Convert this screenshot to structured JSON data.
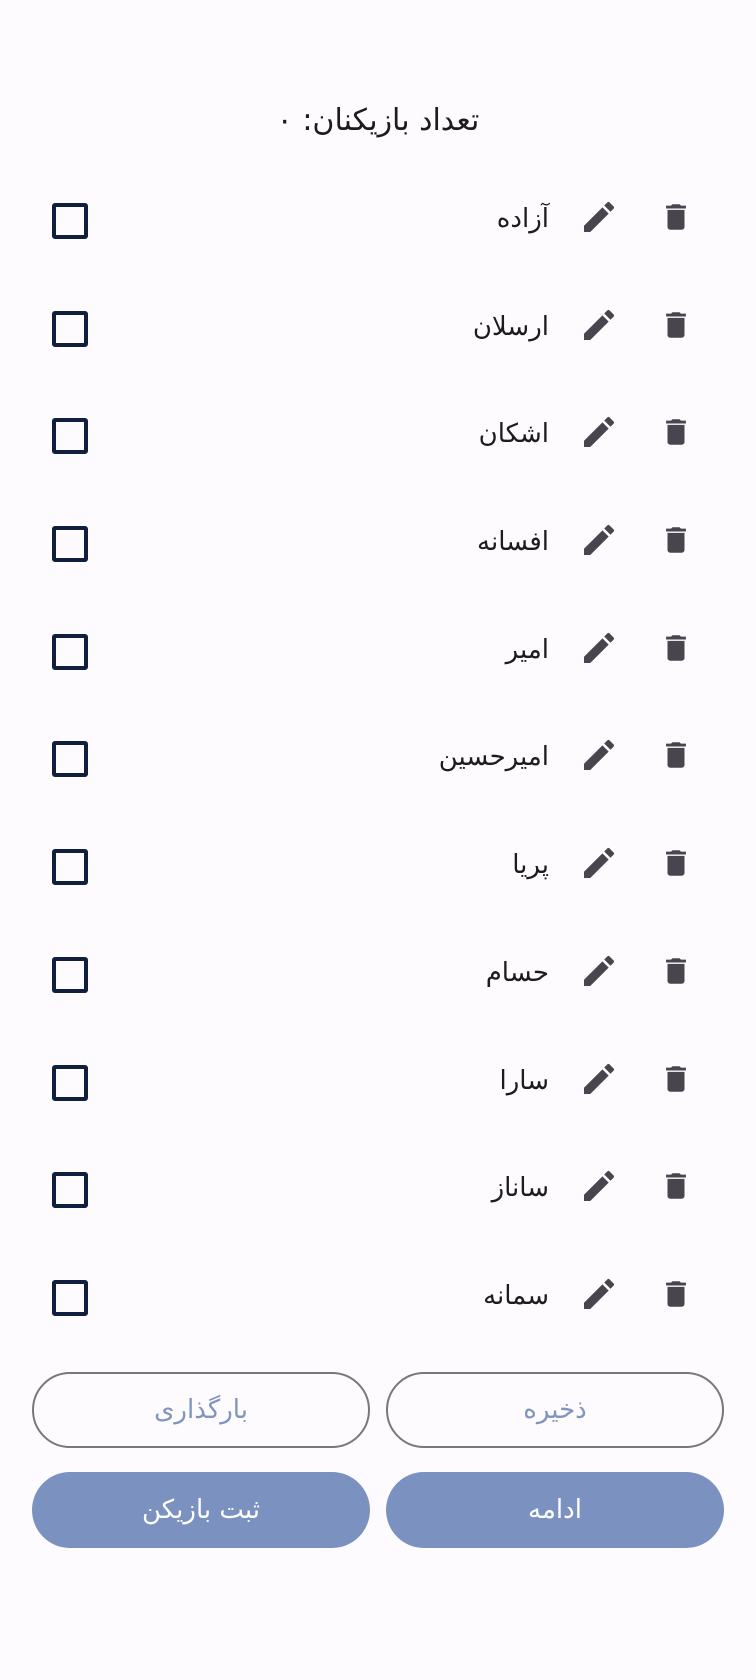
{
  "header": {
    "player_count_label": "تعداد بازیکنان: ۰"
  },
  "players": [
    {
      "name": "آزاده"
    },
    {
      "name": "ارسلان"
    },
    {
      "name": "اشکان"
    },
    {
      "name": "افسانه"
    },
    {
      "name": "امیر"
    },
    {
      "name": "امیرحسین"
    },
    {
      "name": "پریا"
    },
    {
      "name": "حسام"
    },
    {
      "name": "سارا"
    },
    {
      "name": "ساناز"
    },
    {
      "name": "سمانه"
    }
  ],
  "buttons": {
    "save": "ذخیره",
    "load": "بارگذاری",
    "continue": "ادامه",
    "register_player": "ثبت بازیکن"
  },
  "icons": {
    "delete": "trash-icon",
    "edit": "pencil-icon",
    "select": "checkbox"
  },
  "colors": {
    "icon": "#49454f",
    "checkbox_border": "#0f1f3d",
    "outline_button_text": "#8094c0",
    "filled_button_bg": "#7b92c0",
    "background": "#fdfbfe"
  }
}
